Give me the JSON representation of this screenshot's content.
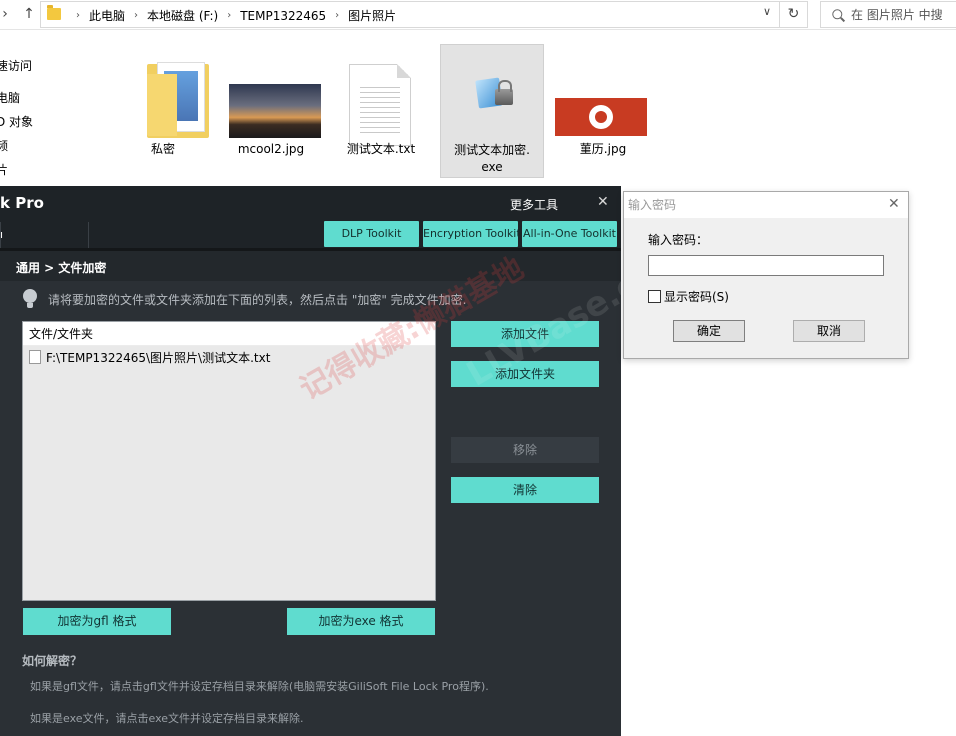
{
  "explorer": {
    "breadcrumbs": [
      "此电脑",
      "本地磁盘 (F:)",
      "TEMP1322465",
      "图片照片"
    ],
    "search_placeholder": "在 图片照片 中搜",
    "nav_items": [
      "速访问",
      "电脑",
      "D 对象",
      "频",
      "片"
    ],
    "files": [
      {
        "name": "私密",
        "icon": "folder-icon"
      },
      {
        "name": "mcool2.jpg",
        "icon": "image-thumbnail"
      },
      {
        "name": "测试文本.txt",
        "icon": "text-file-icon"
      },
      {
        "name": "测试文本加密.\nexe",
        "icon": "locked-exe-icon",
        "selected": true
      },
      {
        "name": "菫历.jpg",
        "icon": "image-thumbnail"
      }
    ]
  },
  "app": {
    "title": "k Pro",
    "more_tools": "更多工具",
    "toolbar_buttons": [
      "DLP Toolkit",
      "Encryption Toolkit",
      "All-in-One Toolkit"
    ],
    "breadcrumb": "通用 > 文件加密",
    "hint": "请将要加密的文件或文件夹添加在下面的列表，然后点击 \"加密\" 完成文件加密.",
    "list_header": "文件/文件夹",
    "list_items": [
      "F:\\TEMP1322465\\图片照片\\测试文本.txt"
    ],
    "side_buttons": {
      "add_file": "添加文件",
      "add_folder": "添加文件夹",
      "remove": "移除",
      "clear": "清除"
    },
    "bottom_buttons": {
      "encrypt_gfl": "加密为gfl 格式",
      "encrypt_exe": "加密为exe 格式"
    },
    "how_title": "如何解密？",
    "how_lines": [
      "如果是gfl文件，请点击gfl文件并设定存档目录来解除(电脑需安装GiliSoft File Lock Pro程序).",
      "如果是exe文件，请点击exe文件并设定存档目录来解除."
    ]
  },
  "dialog": {
    "title": "输入密码",
    "label": "输入密码：",
    "input_value": "",
    "show_password": "显示密码(S)",
    "ok": "确定",
    "cancel": "取消"
  },
  "watermark": {
    "text": "记得收藏:懒猫基地",
    "text2": "LLVBase.com"
  },
  "colors": {
    "accent": "#5fdccf",
    "app_bg": "#2b3035",
    "titlebar": "#1e2327"
  }
}
